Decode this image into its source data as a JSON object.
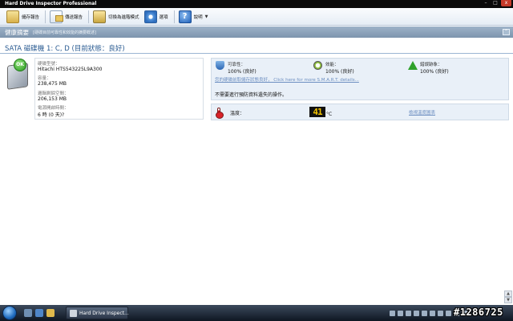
{
  "window": {
    "title": "Hard Drive Inspector Professional",
    "controls": [
      "–",
      "□",
      "x"
    ]
  },
  "toolbar": {
    "save_report": "儲存報告",
    "send_report": "傳送報告",
    "switch_mode": "切換為進階模式",
    "options": "選項",
    "help": "說明"
  },
  "summary": {
    "title": "健康摘要",
    "subtitle": "[硬碟目前可靠性和效能的摘要概述]",
    "collapse": "⌃"
  },
  "drive": {
    "heading": "SATA 磁碟機 1: C, D (目前狀態：良好)",
    "status_badge": "OK",
    "model_label": "硬碟型號：",
    "model_value": "Hitachi HTS543225L9A300",
    "capacity_label": "容量：",
    "capacity_value": "238,475 MB",
    "free_label": "邏輯剩餘空間：",
    "free_value": "206,153 MB",
    "power_label": "電源開啟時間：",
    "power_value": "6 時 (0 天)?"
  },
  "status": {
    "reliability_label": "可靠性：",
    "reliability_value": "100% (良好)",
    "performance_label": "效能：",
    "performance_value": "100% (良好)",
    "errors_label": "錯誤跡象：",
    "errors_value": "100% (良好)",
    "link": "您的硬碟前取儲存狀態良好，  Click here for more S.M.A.R.T. details...",
    "note": "不需要進行預防資料遺失的操作。"
  },
  "temperature": {
    "label": "溫度：",
    "value": "41",
    "unit": "°C",
    "link": "檢視溫度圖表"
  },
  "scrollbar": {
    "up": "▲",
    "down": "▼"
  },
  "taskbar": {
    "task_label": "Hard Drive Inspect...",
    "clock": "下午"
  },
  "watermark": "#1286725"
}
